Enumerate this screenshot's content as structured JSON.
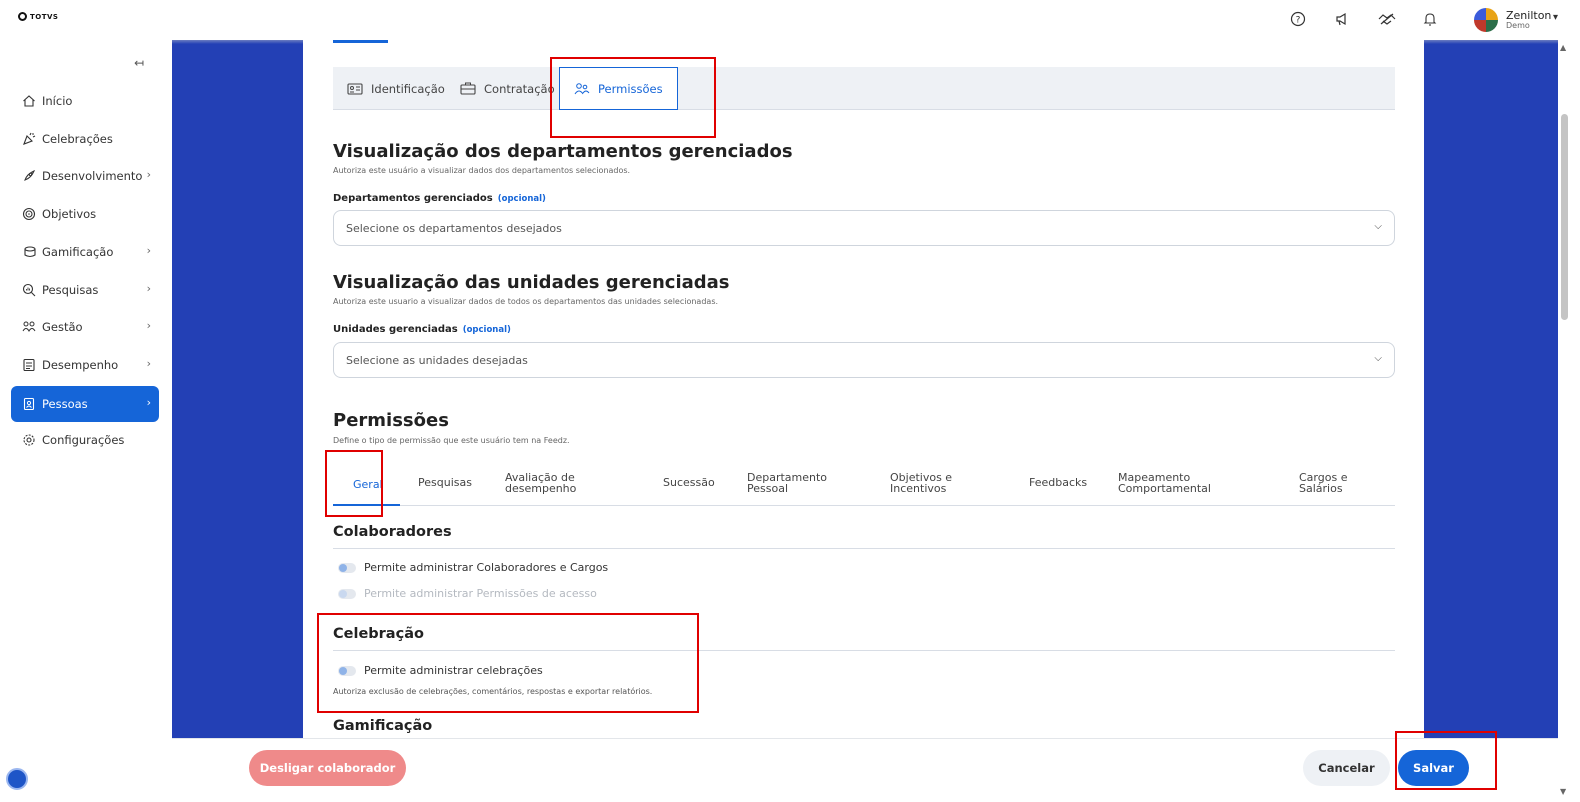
{
  "brand": {
    "logo_text": "TOTVS"
  },
  "header": {
    "user_name": "Zenilton",
    "user_sub": "Demo",
    "icons": [
      "help-icon",
      "megaphone-icon",
      "handshake-icon",
      "bell-icon",
      "user-avatar"
    ]
  },
  "sidebar": {
    "collapse_glyph": "↤",
    "items": [
      {
        "label": "Início",
        "icon": "home-icon",
        "has_children": false
      },
      {
        "label": "Celebrações",
        "icon": "party-icon",
        "has_children": false
      },
      {
        "label": "Desenvolvimento",
        "icon": "rocket-icon",
        "has_children": true
      },
      {
        "label": "Objetivos",
        "icon": "target-icon",
        "has_children": false
      },
      {
        "label": "Gamificação",
        "icon": "coins-icon",
        "has_children": true
      },
      {
        "label": "Pesquisas",
        "icon": "search-chart-icon",
        "has_children": true
      },
      {
        "label": "Gestão",
        "icon": "people-icon",
        "has_children": true
      },
      {
        "label": "Desempenho",
        "icon": "checklist-icon",
        "has_children": true
      },
      {
        "label": "Pessoas",
        "icon": "badge-icon",
        "has_children": true,
        "active": true
      },
      {
        "label": "Configurações",
        "icon": "gear-icon",
        "has_children": false
      }
    ]
  },
  "tabs": [
    {
      "label": "Identificação",
      "icon": "id-card-icon"
    },
    {
      "label": "Contratação",
      "icon": "briefcase-icon"
    },
    {
      "label": "Permissões",
      "icon": "users-icon",
      "active": true
    }
  ],
  "departamentos": {
    "title": "Visualização dos departamentos gerenciados",
    "desc": "Autoriza este usuário a visualizar dados dos departamentos selecionados.",
    "label": "Departamentos gerenciados",
    "optional": "(opcional)",
    "placeholder": "Selecione os departamentos desejados"
  },
  "unidades": {
    "title": "Visualização das unidades gerenciadas",
    "desc": "Autoriza este usuario a visualizar dados de todos os departamentos das unidades selecionadas.",
    "label": "Unidades gerenciadas",
    "optional": "(opcional)",
    "placeholder": "Selecione as unidades desejadas"
  },
  "permissoes": {
    "title": "Permissões",
    "desc": "Define o tipo de permissão que este usuário tem na Feedz.",
    "tabs": [
      {
        "line1": "Geral",
        "line2": ""
      },
      {
        "line1": "Pesquisas",
        "line2": ""
      },
      {
        "line1": "Avaliação de",
        "line2": "desempenho"
      },
      {
        "line1": "Sucessão",
        "line2": ""
      },
      {
        "line1": "Departamento",
        "line2": "Pessoal"
      },
      {
        "line1": "Objetivos e",
        "line2": "Incentivos"
      },
      {
        "line1": "Feedbacks",
        "line2": ""
      },
      {
        "line1": "Mapeamento",
        "line2": "Comportamental"
      },
      {
        "line1": "Cargos e",
        "line2": "Salários"
      }
    ]
  },
  "colaboradores": {
    "title": "Colaboradores",
    "toggle1": "Permite administrar Colaboradores e Cargos",
    "toggle2": "Permite administrar Permissões de acesso"
  },
  "celebracao": {
    "title": "Celebração",
    "toggle1": "Permite administrar celebrações",
    "desc": "Autoriza exclusão de celebrações, comentários, respostas e exportar relatórios."
  },
  "gamificacao": {
    "title": "Gamificação"
  },
  "footer": {
    "dismiss_label": "Desligar colaborador",
    "cancel_label": "Cancelar",
    "save_label": "Salvar"
  },
  "colors": {
    "primary": "#1565d8",
    "background_blue": "#2340b5",
    "danger": "#ef8a8a",
    "highlight": "#e00000"
  }
}
